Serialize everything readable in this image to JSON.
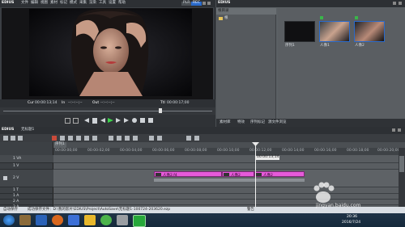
{
  "player": {
    "logo": "EDIUS",
    "menu": [
      "文件",
      "编辑",
      "视图",
      "素材",
      "标记",
      "模式",
      "采集",
      "渲染",
      "工具",
      "设置",
      "帮助"
    ],
    "mode_badges": [
      "PLR",
      "REC"
    ],
    "timecodes": {
      "cur": "00:00:13;14",
      "in": "--:--:--;--",
      "out": "--:--:--;--",
      "ttl": "00:00:17;00"
    },
    "tc_labels": [
      "Cur",
      "In",
      "Out",
      "Ttl"
    ]
  },
  "bin": {
    "logo": "EDIUS",
    "tree_header": "根目录",
    "tree_item": "根",
    "clips": [
      {
        "caption": "序列1",
        "selected": false
      },
      {
        "caption": "人像1",
        "selected": true
      },
      {
        "caption": "人像2",
        "selected": true
      }
    ],
    "tabs": [
      "素材库",
      "特效",
      "序列标记",
      "源文件浏览"
    ]
  },
  "timeline": {
    "logo": "EDIUS",
    "title": "无标题1",
    "sequence_tab": "序列1",
    "ruler_labels": [
      "00:00:00;00",
      "00:00:02;00",
      "00:00:04;00",
      "00:00:06;00",
      "00:00:08;00",
      "00:00:10;00",
      "00:00:12;00",
      "00:00:14;00",
      "00:00:16;00",
      "00:00:18;00",
      "00:00:20;00"
    ],
    "playhead_tc": "00:00:13;14",
    "tracks": [
      {
        "name": "1 VA",
        "kind": "VA"
      },
      {
        "name": "1 V",
        "kind": "V"
      },
      {
        "name": "2 V",
        "kind": "V"
      },
      {
        "name": "1 T",
        "kind": "T"
      },
      {
        "name": "1 A",
        "kind": "A"
      },
      {
        "name": "2 A",
        "kind": "A"
      },
      {
        "name": "3 A",
        "kind": "A"
      }
    ],
    "clips": [
      {
        "label": "人像2.f4",
        "track": 2
      },
      {
        "label": "人像2",
        "track": 2
      },
      {
        "label": "人像2",
        "track": 2
      }
    ]
  },
  "statusbar": {
    "left": "自动保存",
    "path": "成功保存文件：D:\\我的影片\\EDIUS\\Project\\AutoSave\\无标题1-100724-203620.ezp",
    "right": "警告"
  },
  "taskbar": {
    "watermark": "jingyan.baidu.com",
    "clock_time": "20:36",
    "clock_date": "2016/7/24"
  },
  "colors": {
    "clip_pink": "#e55ad9",
    "accent_blue": "#2a6acb",
    "panel_dark": "#2d3034"
  }
}
